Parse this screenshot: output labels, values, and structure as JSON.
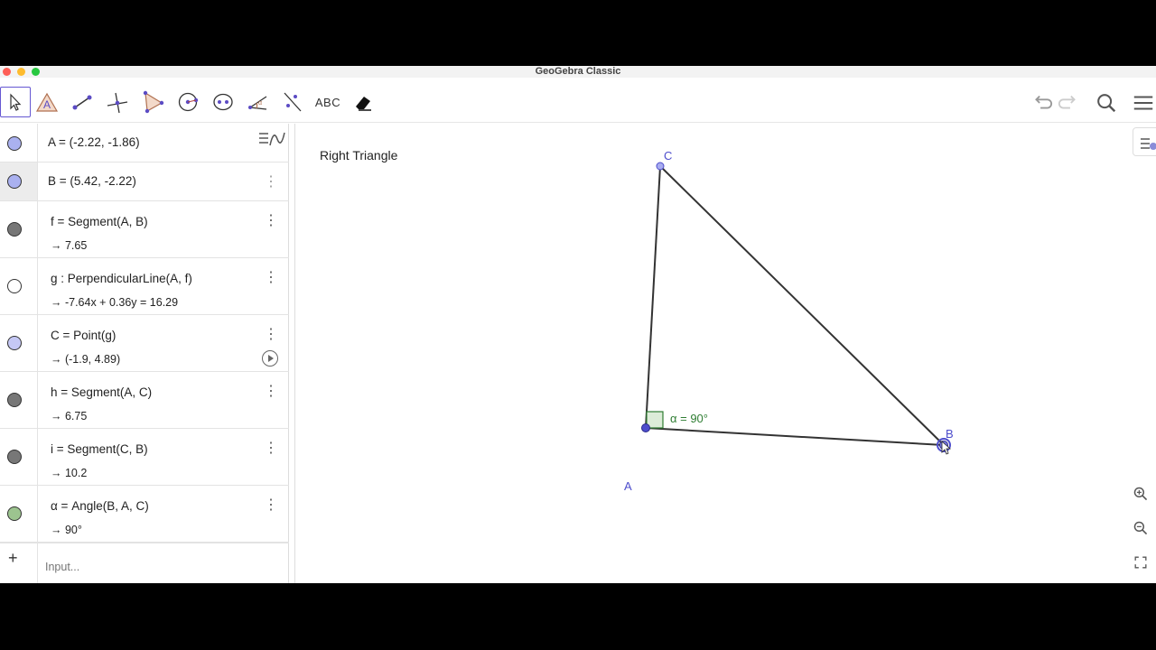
{
  "window": {
    "title": "GeoGebra Classic"
  },
  "toolbar": {
    "tools": [
      {
        "name": "move-tool-icon",
        "selected": true
      },
      {
        "name": "text-tool-icon",
        "selected": false
      },
      {
        "name": "segment-tool-icon",
        "selected": false
      },
      {
        "name": "perpendicular-line-tool-icon",
        "selected": false
      },
      {
        "name": "polygon-tool-icon",
        "selected": false
      },
      {
        "name": "circle-tool-icon",
        "selected": false
      },
      {
        "name": "ellipse-tool-icon",
        "selected": false
      },
      {
        "name": "angle-tool-icon",
        "selected": false
      },
      {
        "name": "reflect-tool-icon",
        "selected": false
      },
      {
        "name": "text-abc-tool",
        "selected": false
      },
      {
        "name": "eraser-tool-icon",
        "selected": false
      }
    ],
    "abc_label": "ABC",
    "right": [
      "undo-icon",
      "redo-icon",
      "search-icon",
      "menu-icon"
    ]
  },
  "algebra": {
    "rows": [
      {
        "definition": "A = (-2.22, -1.86)",
        "value": "",
        "color": "#aab1f0"
      },
      {
        "definition": "B = (5.42, -2.22)",
        "value": "",
        "color": "#aab1f0"
      },
      {
        "definition": "f = Segment(A, B)",
        "value": "→ 7.65",
        "color": "#777777"
      },
      {
        "definition": "g : PerpendicularLine(A, f)",
        "value": "→ -7.64x + 0.36y = 16.29",
        "color": "#ffffff"
      },
      {
        "definition": "C = Point(g)",
        "value": "→ (-1.9, 4.89)",
        "color": "#c5c8f5"
      },
      {
        "definition": "h = Segment(A, C)",
        "value": "→ 6.75",
        "color": "#777777"
      },
      {
        "definition": "i = Segment(C, B)",
        "value": "→ 10.2",
        "color": "#777777"
      },
      {
        "definition": "α = Angle(B, A, C)",
        "value": "→ 90°",
        "color": "#9cc48f"
      }
    ],
    "input_placeholder": "Input..."
  },
  "graphics": {
    "title": "Right Triangle",
    "points": {
      "A": "A",
      "B": "B",
      "C": "C"
    },
    "angle_label": "α = 90°",
    "colors": {
      "point": "#4d4dcc",
      "segment": "#333333",
      "angle": "#2e7d32"
    }
  }
}
